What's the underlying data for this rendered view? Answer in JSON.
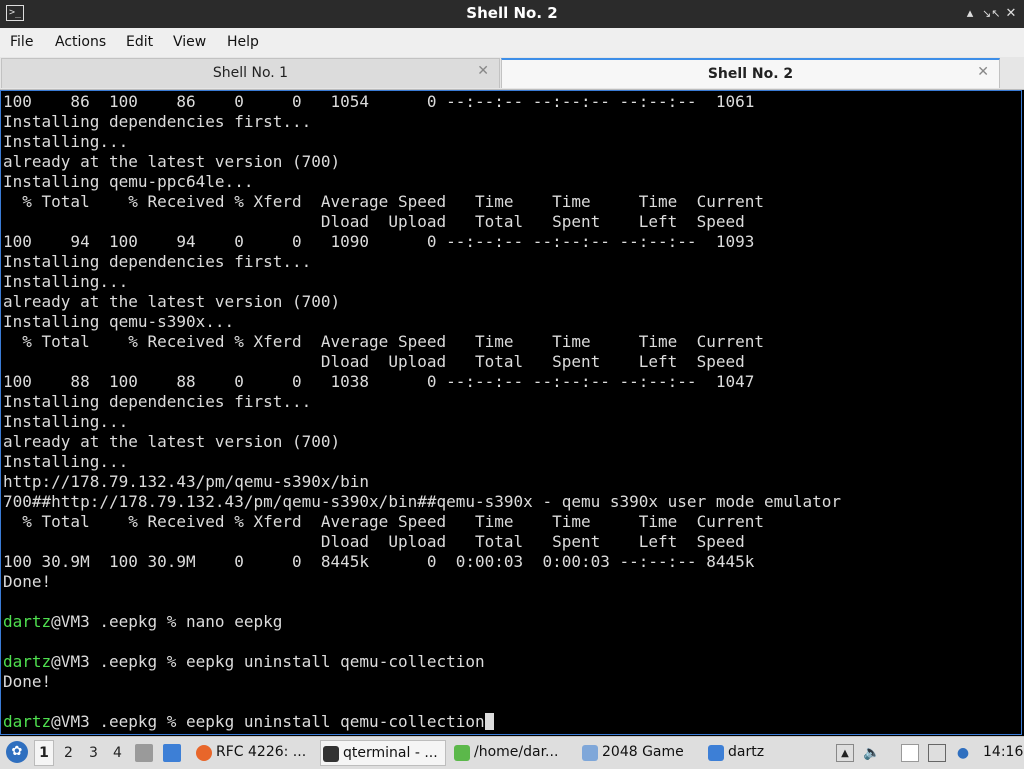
{
  "window": {
    "title": "Shell No. 2",
    "controls": [
      "▴",
      "↘↖",
      "✕"
    ]
  },
  "menu": [
    "File",
    "Actions",
    "Edit",
    "View",
    "Help"
  ],
  "tabs": [
    {
      "label": "Shell No. 1",
      "active": false
    },
    {
      "label": "Shell No. 2",
      "active": true
    }
  ],
  "terminal": {
    "lines": [
      {
        "text": "100    86  100    86    0     0   1054      0 --:--:-- --:--:-- --:--:--  1061"
      },
      {
        "text": "Installing dependencies first..."
      },
      {
        "text": "Installing..."
      },
      {
        "text": "already at the latest version (700)"
      },
      {
        "text": "Installing qemu-ppc64le..."
      },
      {
        "text": "  % Total    % Received % Xferd  Average Speed   Time    Time     Time  Current"
      },
      {
        "text": "                                 Dload  Upload   Total   Spent    Left  Speed"
      },
      {
        "text": "100    94  100    94    0     0   1090      0 --:--:-- --:--:-- --:--:--  1093"
      },
      {
        "text": "Installing dependencies first..."
      },
      {
        "text": "Installing..."
      },
      {
        "text": "already at the latest version (700)"
      },
      {
        "text": "Installing qemu-s390x..."
      },
      {
        "text": "  % Total    % Received % Xferd  Average Speed   Time    Time     Time  Current"
      },
      {
        "text": "                                 Dload  Upload   Total   Spent    Left  Speed"
      },
      {
        "text": "100    88  100    88    0     0   1038      0 --:--:-- --:--:-- --:--:--  1047"
      },
      {
        "text": "Installing dependencies first..."
      },
      {
        "text": "Installing..."
      },
      {
        "text": "already at the latest version (700)"
      },
      {
        "text": "Installing..."
      },
      {
        "text": "http://178.79.132.43/pm/qemu-s390x/bin"
      },
      {
        "text": "700##http://178.79.132.43/pm/qemu-s390x/bin##qemu-s390x - qemu s390x user mode emulator"
      },
      {
        "text": "  % Total    % Received % Xferd  Average Speed   Time    Time     Time  Current"
      },
      {
        "text": "                                 Dload  Upload   Total   Spent    Left  Speed"
      },
      {
        "text": "100 30.9M  100 30.9M    0     0  8445k      0  0:00:03  0:00:03 --:--:-- 8445k"
      },
      {
        "text": "Done!"
      },
      {
        "text": ""
      },
      {
        "user": "dartz",
        "text": "@VM3 .eepkg % nano eepkg"
      },
      {
        "text": ""
      },
      {
        "user": "dartz",
        "text": "@VM3 .eepkg % eepkg uninstall qemu-collection"
      },
      {
        "text": "Done!"
      },
      {
        "text": ""
      },
      {
        "user": "dartz",
        "text": "@VM3 .eepkg % eepkg uninstall qemu-collection",
        "cursor": true
      }
    ]
  },
  "taskbar": {
    "workspaces": [
      "1",
      "2",
      "3",
      "4"
    ],
    "tasks": [
      {
        "label": "RFC 4226: ...",
        "icon": "firefox-icon",
        "color": "#e8662a"
      },
      {
        "label": "qterminal - ...",
        "icon": "terminal-icon",
        "color": "#333333"
      },
      {
        "label": "/home/dar...",
        "icon": "file-manager-icon",
        "color": "#5bb84a"
      },
      {
        "label": "2048 Game",
        "icon": "window-icon",
        "color": "#7fa7d9"
      },
      {
        "label": "dartz",
        "icon": "folder-icon",
        "color": "#3d7fd6"
      }
    ],
    "clock": "14:16"
  }
}
